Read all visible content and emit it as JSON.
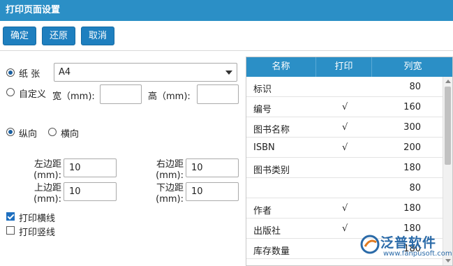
{
  "window": {
    "title": "打印页面设置"
  },
  "toolbar": {
    "confirm": "确定",
    "restore": "还原",
    "cancel": "取消"
  },
  "paper": {
    "paper_radio_label": "纸 张",
    "paper_selected": true,
    "paper_size": "A4",
    "custom_radio_label": "自定义",
    "width_label": "宽（mm):",
    "width_value": "",
    "height_label": "高（mm):",
    "height_value": ""
  },
  "orientation": {
    "portrait_label": "纵向",
    "landscape_label": "横向",
    "selected": "portrait"
  },
  "margins": {
    "left_label": "左边距\n(mm):",
    "left_value": "10",
    "right_label": "右边距\n(mm):",
    "right_value": "10",
    "top_label": "上边距\n(mm):",
    "top_value": "10",
    "bottom_label": "下边距\n(mm):",
    "bottom_value": "10"
  },
  "options": {
    "print_hlines_label": "打印横线",
    "print_hlines_checked": true,
    "print_vlines_label": "打印竖线",
    "print_vlines_checked": false
  },
  "grid": {
    "headers": [
      "名称",
      "打印",
      "列宽"
    ],
    "rows": [
      {
        "name": "标识",
        "print": "",
        "width": "80"
      },
      {
        "name": "编号",
        "print": "√",
        "width": "160"
      },
      {
        "name": "图书名称",
        "print": "√",
        "width": "300"
      },
      {
        "name": "ISBN",
        "print": "√",
        "width": "200"
      },
      {
        "name": "图书类别",
        "print": "",
        "width": "180"
      },
      {
        "name": "",
        "print": "",
        "width": "80"
      },
      {
        "name": "作者",
        "print": "√",
        "width": "180"
      },
      {
        "name": "出版社",
        "print": "√",
        "width": "180"
      },
      {
        "name": "库存数量",
        "print": "",
        "width": "180"
      }
    ]
  },
  "watermark": {
    "brand": "泛普软件",
    "url": "www.fanpusoft.com"
  },
  "colors": {
    "title_bar": "#2b8fc6",
    "button": "#1e7fbf",
    "grid_header": "#2b8fc6"
  }
}
